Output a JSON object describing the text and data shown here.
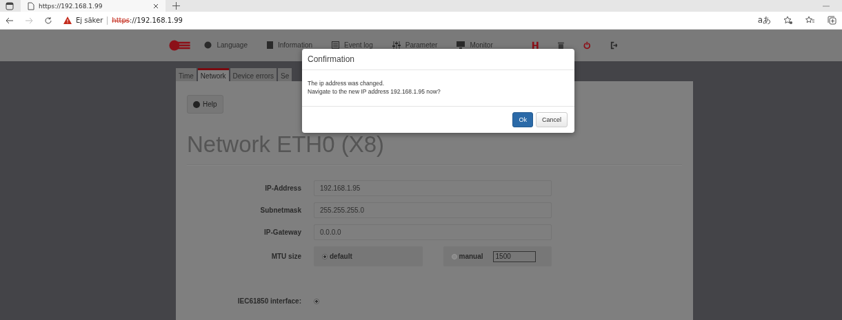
{
  "browser": {
    "tab_title": "https://192.168.1.99",
    "security_label": "Ej säker",
    "url_scheme": "https",
    "url_rest": "://192.168.1.99",
    "reader_label": "aあ"
  },
  "nav": [
    {
      "label": "Language"
    },
    {
      "label": "Information"
    },
    {
      "label": "Event log"
    },
    {
      "label": "Parameter"
    },
    {
      "label": "Monitor"
    }
  ],
  "tabs": [
    {
      "label": "Time",
      "selected": false
    },
    {
      "label": "Network",
      "selected": true
    },
    {
      "label": "Device errors",
      "selected": false
    },
    {
      "label": "Se",
      "selected": false
    }
  ],
  "help_button": "Help",
  "heading": "Network ETH0 (X8)",
  "fields": [
    {
      "label": "IP-Address",
      "value": "192.168.1.95"
    },
    {
      "label": "Subnetmask",
      "value": "255.255.255.0"
    },
    {
      "label": "IP-Gateway",
      "value": "0.0.0.0"
    }
  ],
  "mtu": {
    "label": "MTU size",
    "options": [
      {
        "label": "default",
        "selected": true
      },
      {
        "label": "manual",
        "selected": false
      }
    ],
    "manual_value": "1500"
  },
  "iec": {
    "label": "IEC61850 interface:",
    "checked": true
  },
  "dialog": {
    "title": "Confirmation",
    "message": [
      "The ip address was changed.",
      "Navigate to the new IP address 192.168.1.95 now?"
    ],
    "buttons": [
      {
        "label": "Ok",
        "kind": "primary"
      },
      {
        "label": "Cancel",
        "kind": "default"
      }
    ]
  }
}
